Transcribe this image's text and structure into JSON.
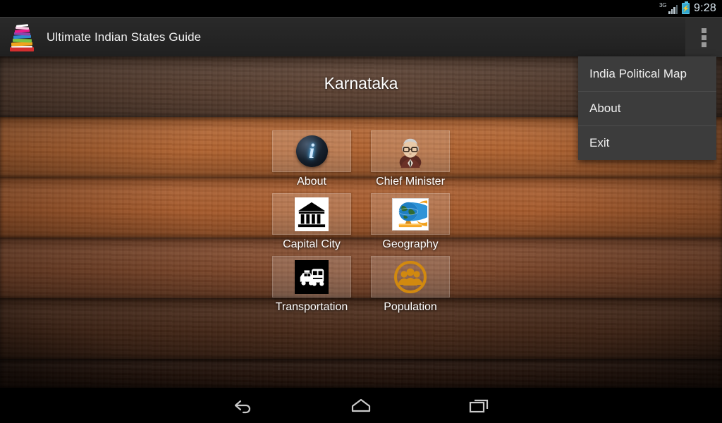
{
  "status_bar": {
    "network_label": "3G",
    "battery_icon": "battery-charging-icon",
    "signal_icon": "signal-bars-icon",
    "time": "9:28"
  },
  "action_bar": {
    "app_icon": "book-stack-icon",
    "title": "Ultimate Indian States Guide",
    "overflow_icon": "overflow-menu-icon"
  },
  "main": {
    "state_title": "Karnataka",
    "grid_rows": [
      [
        {
          "label": "About",
          "icon": "info-circle-icon"
        },
        {
          "label": "Chief Minister",
          "icon": "politician-portrait-icon"
        }
      ],
      [
        {
          "label": "Capital City",
          "icon": "classical-building-icon"
        },
        {
          "label": "Geography",
          "icon": "globe-stand-icon"
        }
      ],
      [
        {
          "label": "Transportation",
          "icon": "taxi-bus-icon"
        },
        {
          "label": "Population",
          "icon": "people-group-icon"
        }
      ]
    ]
  },
  "overflow_menu": {
    "items": [
      {
        "label": "India Political Map"
      },
      {
        "label": "About"
      },
      {
        "label": "Exit"
      }
    ]
  },
  "nav_bar": {
    "back": "back-arrow-icon",
    "home": "home-icon",
    "recents": "recent-apps-icon"
  },
  "colors": {
    "action_bar": "#222222",
    "menu_bg": "#3c3c3c",
    "wood_light": "#b0622f",
    "wood_dark": "#30190e",
    "accent_orange": "#d68a20",
    "text_primary": "#ffffff"
  }
}
